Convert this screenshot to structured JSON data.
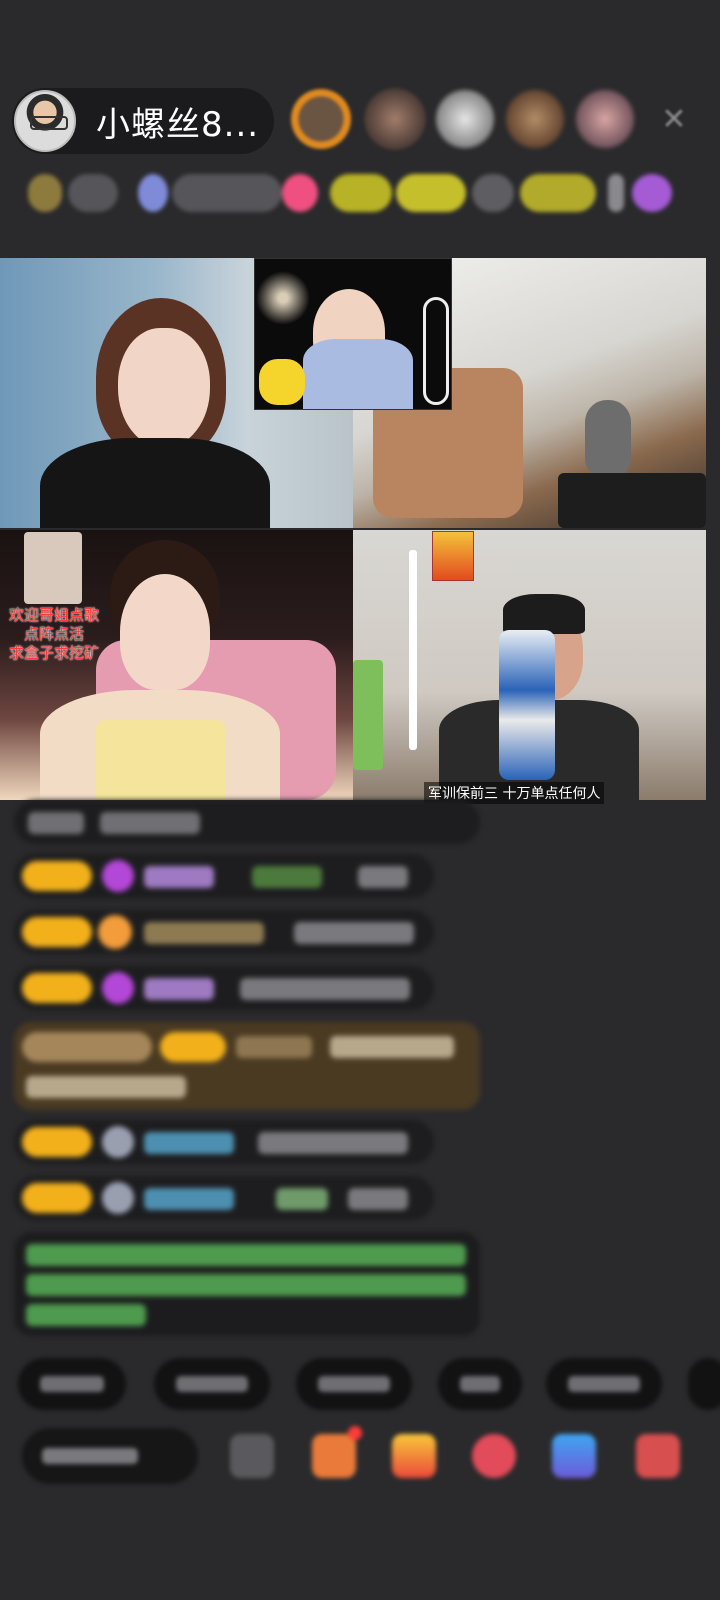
{
  "header": {
    "host_name": "小螺丝8...",
    "close_icon": "close-icon"
  },
  "video": {
    "tile4_overlay": [
      "欢迎哥姐点歌",
      "点阵点活",
      "求盒子求挖矿"
    ],
    "tile5_caption": "军训保前三  十万单点任何人"
  },
  "colors": {
    "background": "#2a2a2c",
    "badge_gold": "#f2b01b",
    "level_purple": "#b347d8",
    "system_msg_green": "#55c25a",
    "highlight_msg_bg": "#4a3a22"
  }
}
